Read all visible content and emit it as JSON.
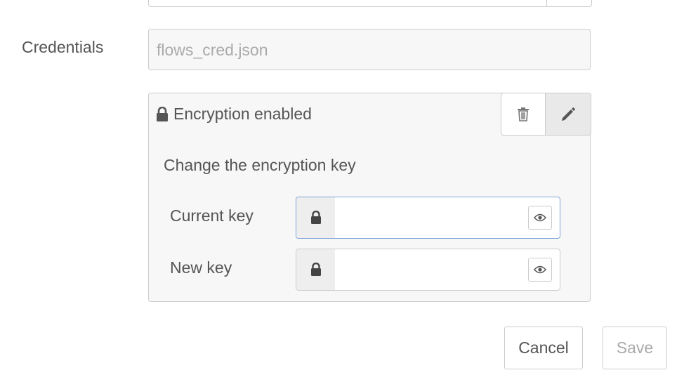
{
  "credentials": {
    "label": "Credentials",
    "file_value": "flows_cred.json"
  },
  "encryption": {
    "title": "Encryption enabled",
    "lock_icon": "lock-icon",
    "delete_icon": "trash-icon",
    "edit_icon": "pencil-icon",
    "change_label": "Change the encryption key",
    "current_key": {
      "label": "Current key",
      "value": "",
      "lock_icon": "lock-icon",
      "reveal_icon": "eye-icon"
    },
    "new_key": {
      "label": "New key",
      "value": "",
      "lock_icon": "lock-icon",
      "reveal_icon": "eye-icon"
    }
  },
  "actions": {
    "cancel_label": "Cancel",
    "save_label": "Save"
  },
  "colors": {
    "text": "#555555",
    "muted": "#aaaaaa",
    "border": "#cccccc",
    "panel_bg": "#f7f7f7",
    "focus_border": "#7fa5d6"
  }
}
